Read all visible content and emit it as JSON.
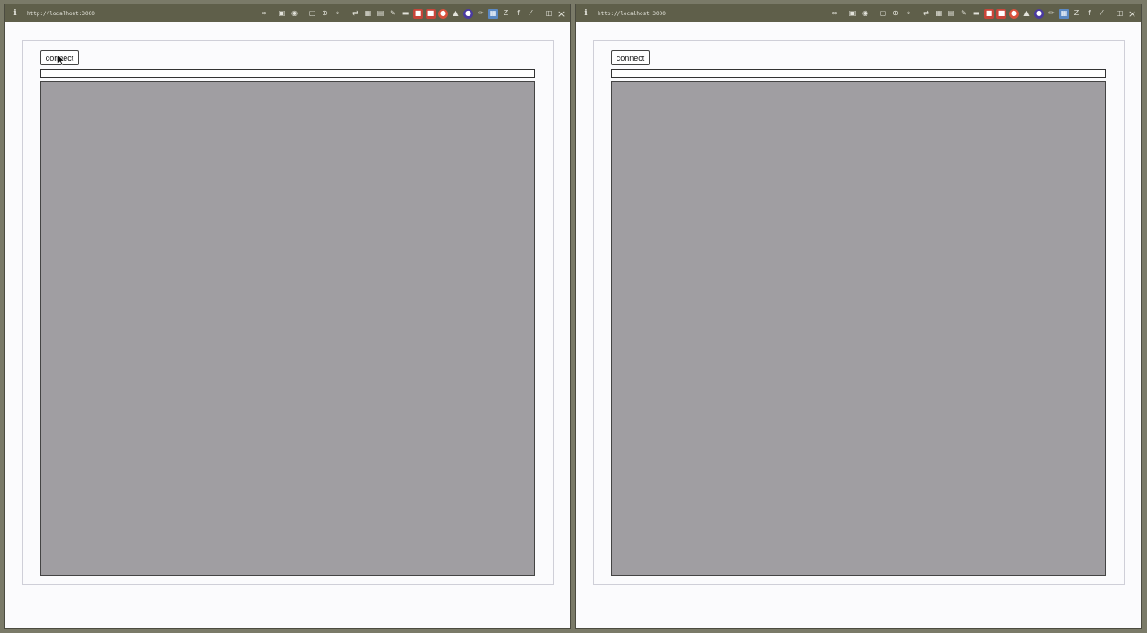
{
  "windows": [
    {
      "id": "left",
      "url": "http://localhost:3000",
      "connect_label": "connect"
    },
    {
      "id": "right",
      "url": "http://localhost:3000",
      "connect_label": "connect"
    }
  ],
  "toolbar_icons": [
    "link-icon",
    "screenshot-icon",
    "camera-icon",
    "window-icon",
    "globe-icon",
    "crosshair-icon",
    "code-icon",
    "extension-icon",
    "form-icon",
    "pen-icon",
    "panel-icon",
    "red-extension-icon",
    "red-circle-icon",
    "triangle-icon",
    "purple-circle-icon",
    "eyedropper-icon",
    "blue-extension-icon",
    "zotero-icon",
    "font-icon",
    "pin-icon",
    "split-view-icon",
    "close-icon"
  ],
  "colors": {
    "titlebar": "#5f5f4a",
    "canvas": "#a09ea2",
    "page": "#fbfbfd"
  }
}
